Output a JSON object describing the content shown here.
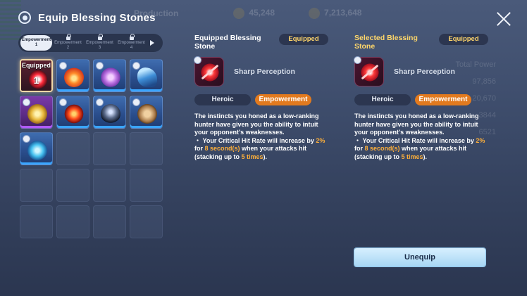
{
  "background_hud": {
    "label_1": "Production",
    "value_1": "45,248",
    "value_2": "7,213,648",
    "side_label": "Total Power",
    "side_values": [
      "97,856",
      "20,670",
      "3844",
      "6521"
    ]
  },
  "header": {
    "title": "Equip Blessing Stones"
  },
  "tabs": [
    {
      "label": "Empowerment",
      "number": "1",
      "locked": false,
      "active": true
    },
    {
      "label": "Empowerment",
      "number": "2",
      "locked": true,
      "active": false
    },
    {
      "label": "Empowerment",
      "number": "3",
      "locked": true,
      "active": false
    },
    {
      "label": "Empowerment",
      "number": "4",
      "locked": true,
      "active": false
    }
  ],
  "grid": {
    "equipped_label": "Equipped",
    "equipped_level": "1",
    "slots": [
      {
        "icon": "sharp-perception-stone-icon",
        "frame": "equipped"
      },
      {
        "icon": "fire-stone-icon",
        "frame": "blue"
      },
      {
        "icon": "pink-gem-stone-icon",
        "frame": "blue"
      },
      {
        "icon": "boot-stone-icon",
        "frame": "blue"
      },
      {
        "icon": "golden-claw-stone-icon",
        "frame": "purple"
      },
      {
        "icon": "fire-burst-stone-icon",
        "frame": "blue"
      },
      {
        "icon": "shadow-figure-stone-icon",
        "frame": "blue"
      },
      {
        "icon": "fist-stone-icon",
        "frame": "blue"
      },
      {
        "icon": "aqua-vortex-stone-icon",
        "frame": "blue"
      }
    ],
    "empty_slots": 11
  },
  "equipped_panel": {
    "title": "Equipped Blessing Stone",
    "status": "Equipped",
    "stone_name": "Sharp Perception",
    "rarity": "Heroic",
    "type": "Empowerment",
    "desc_intro": "The instincts you honed as a low-ranking hunter have given you the ability to intuit your opponent's weaknesses.",
    "desc_prefix": "・ Your Critical Hit Rate will increase by ",
    "desc_rate": "2%",
    "desc_for": " for ",
    "desc_duration": "8 second(s)",
    "desc_when": " when your attacks hit (stacking up to ",
    "desc_stacks": "5 times",
    "desc_end": ")."
  },
  "selected_panel": {
    "title": "Selected Blessing Stone",
    "status": "Equipped",
    "stone_name": "Sharp Perception",
    "rarity": "Heroic",
    "type": "Empowerment",
    "desc_intro": "The instincts you honed as a low-ranking hunter have given you the ability to intuit your opponent's weaknesses.",
    "desc_prefix": "・ Your Critical Hit Rate will increase by ",
    "desc_rate": "2%",
    "desc_for": " for ",
    "desc_duration": "8 second(s)",
    "desc_when": " when your attacks hit (stacking up to ",
    "desc_stacks": "5 times",
    "desc_end": ")."
  },
  "actions": {
    "unequip_label": "Unequip"
  },
  "colors": {
    "highlight": "#ffb03a",
    "selected_title": "#ffd76a",
    "empowerment_tag": "#e27a1e"
  }
}
